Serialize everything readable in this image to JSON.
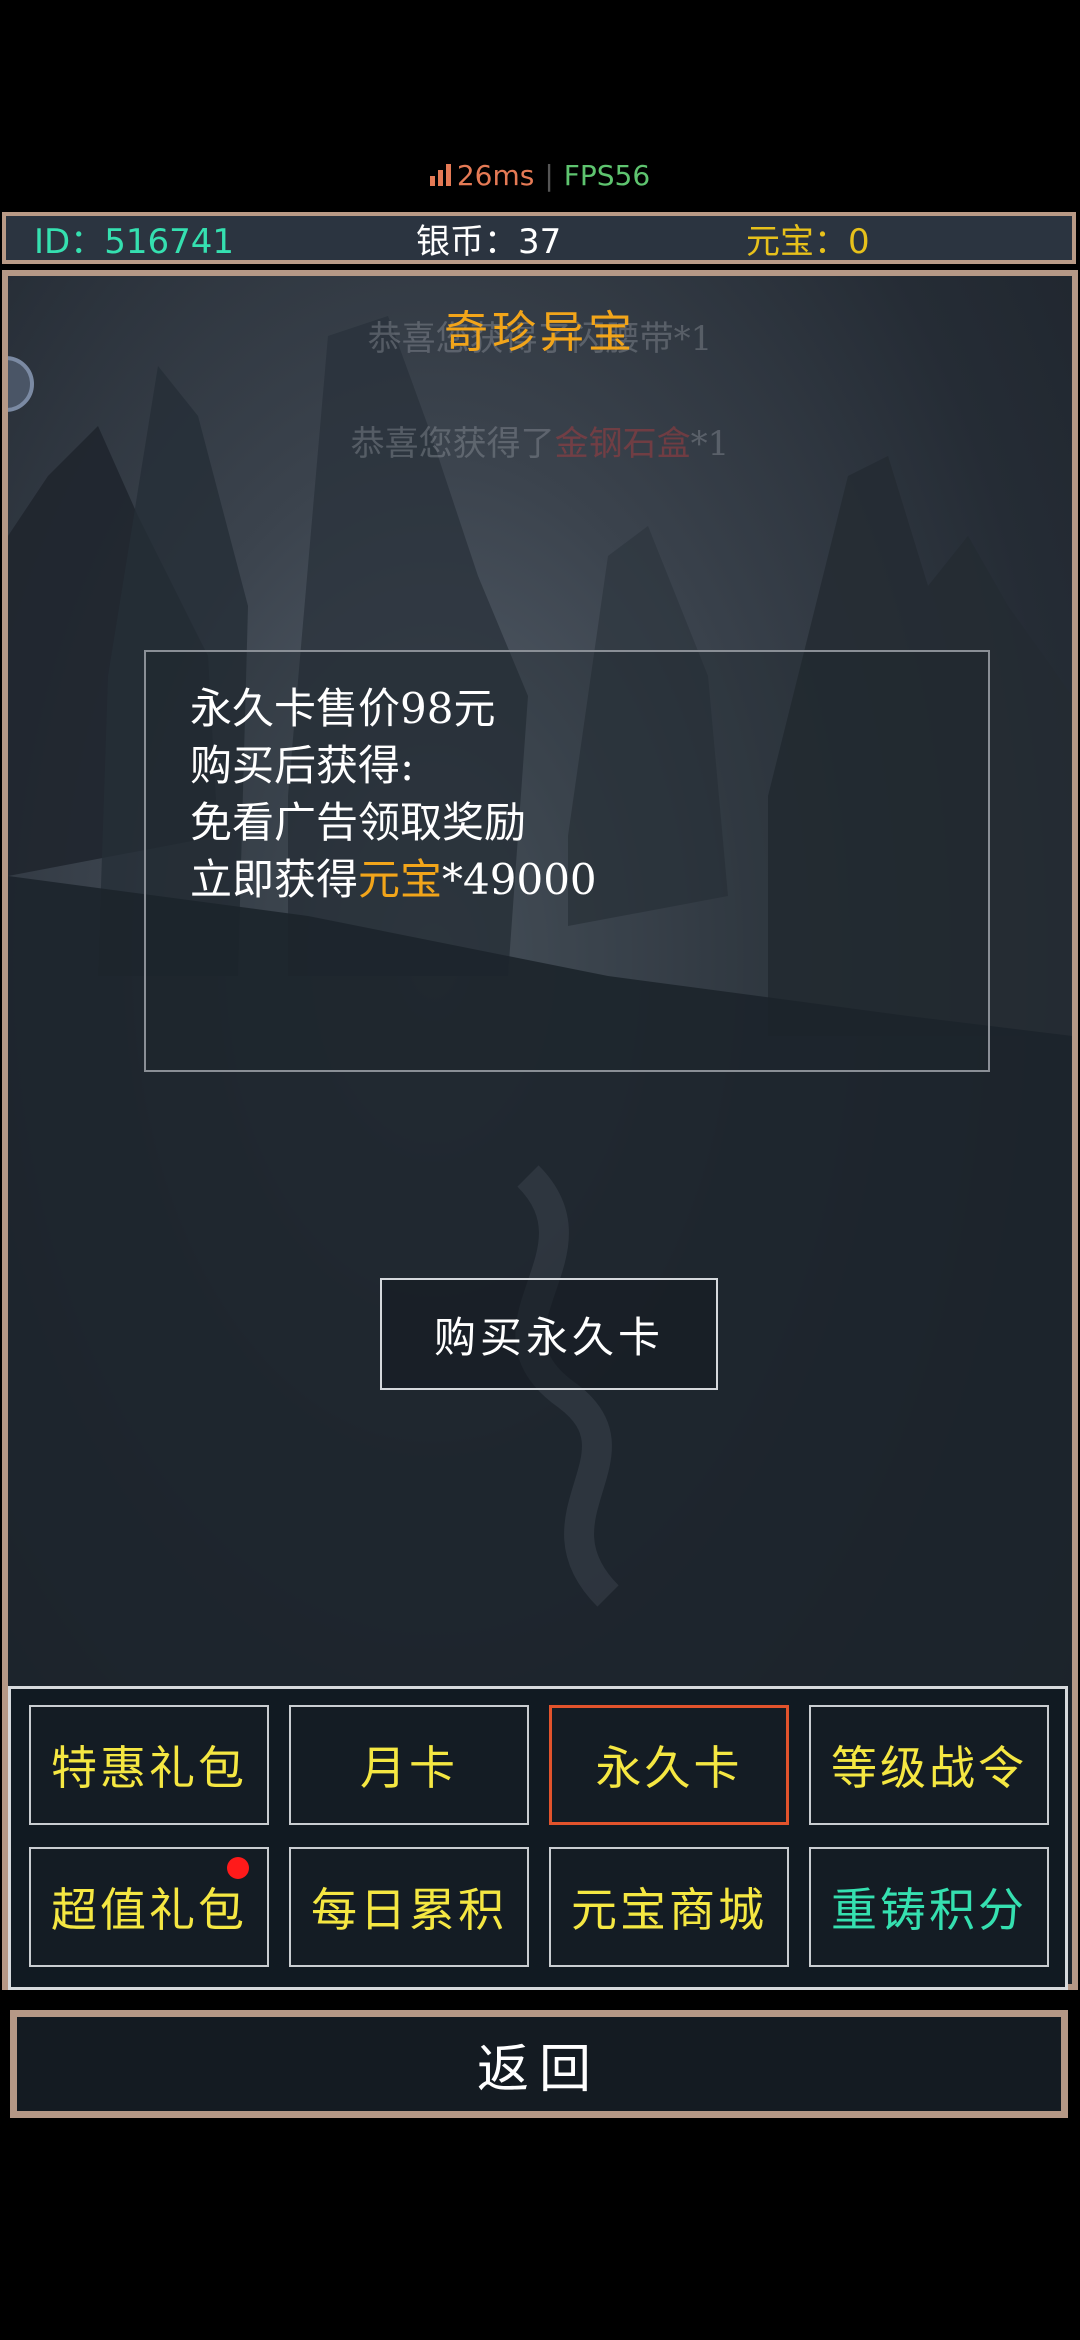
{
  "status": {
    "ping": "26ms",
    "fps": "FPS56"
  },
  "resources": {
    "id": "ID：516741",
    "silver": "银币：37",
    "ingot": "元宝：0"
  },
  "panel": {
    "title": "奇珍异宝",
    "notice1": "恭喜您获得了闪腰带*1",
    "notice2_prefix": "恭喜您获得了",
    "notice2_item": "金钢石盒",
    "notice2_suffix": "*1"
  },
  "card_info": {
    "line1": "永久卡售价98元",
    "line2": "购买后获得:",
    "line3": "免看广告领取奖励",
    "line4_prefix": "立即获得",
    "line4_item": "元宝",
    "line4_suffix": "*49000"
  },
  "buy_button": "购买永久卡",
  "tabs": [
    {
      "label": "特惠礼包"
    },
    {
      "label": "月卡"
    },
    {
      "label": "永久卡",
      "active": true
    },
    {
      "label": "等级战令"
    },
    {
      "label": "超值礼包",
      "badge": true
    },
    {
      "label": "每日累积"
    },
    {
      "label": "元宝商城"
    },
    {
      "label": "重铸积分"
    }
  ],
  "back_button": "返回",
  "colors": {
    "gold": "#f2a51a",
    "tab_text": "#f5e742",
    "cyan": "#35e0b0",
    "active_border": "#e2532c",
    "frame": "#b59886"
  }
}
